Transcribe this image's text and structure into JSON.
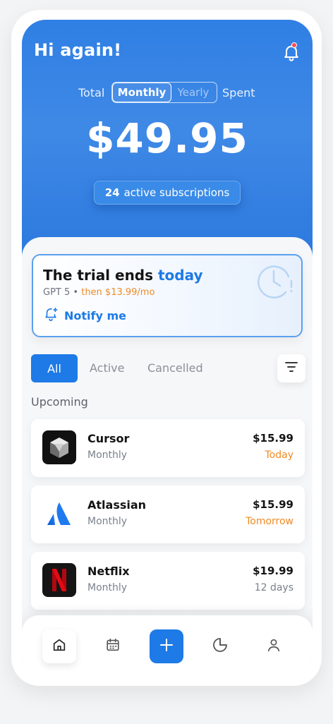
{
  "header": {
    "greeting": "Hi again!",
    "total_label": "Total",
    "toggle": {
      "monthly": "Monthly",
      "yearly": "Yearly",
      "selected": "Monthly"
    },
    "spent_label": "Spent",
    "amount": "$49.95",
    "subscriptions_count": "24",
    "subscriptions_label": "active subscriptions"
  },
  "trial": {
    "title_prefix": "The trial ends ",
    "title_highlight": "today",
    "service": "GPT 5",
    "separator": "•",
    "then_price": "then $13.99/mo",
    "notify_label": "Notify me"
  },
  "tabs": {
    "all": "All",
    "active": "Active",
    "cancelled": "Cancelled",
    "selected": "All"
  },
  "section_title": "Upcoming",
  "subscriptions": [
    {
      "name": "Cursor",
      "cycle": "Monthly",
      "price": "$15.99",
      "due": "Today",
      "icon": "cursor-logo"
    },
    {
      "name": "Atlassian",
      "cycle": "Monthly",
      "price": "$15.99",
      "due": "Tomorrow",
      "icon": "atlassian-logo"
    },
    {
      "name": "Netflix",
      "cycle": "Monthly",
      "price": "$19.99",
      "due": "12 days",
      "icon": "netflix-logo"
    }
  ],
  "colors": {
    "brand": "#1d7ae6",
    "due_soon": "#f08a24",
    "hero": "#2f7fe4"
  },
  "nav": [
    "home-icon",
    "calendar-icon",
    "plus-icon",
    "pie-chart-icon",
    "user-icon"
  ]
}
